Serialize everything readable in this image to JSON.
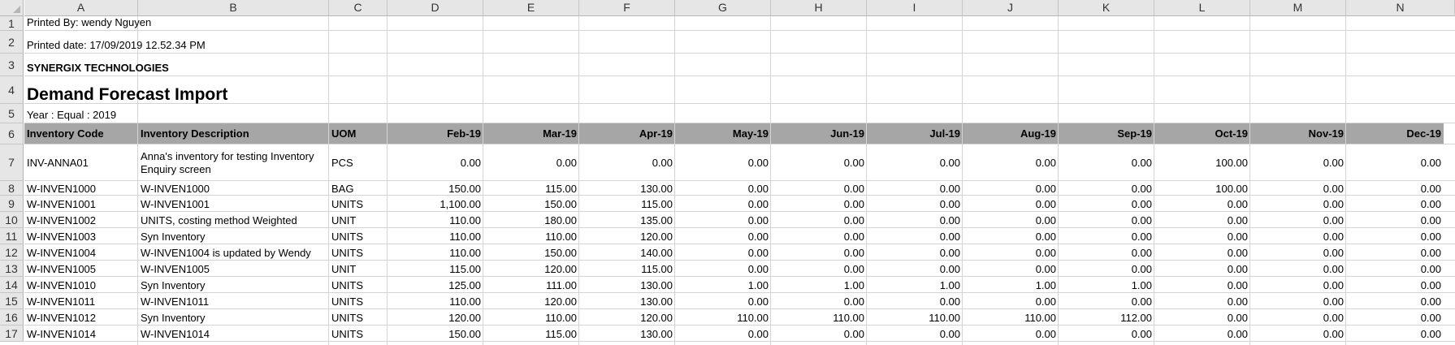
{
  "columns": [
    "A",
    "B",
    "C",
    "D",
    "E",
    "F",
    "G",
    "H",
    "I",
    "J",
    "K",
    "L",
    "M",
    "N"
  ],
  "rows": [
    "1",
    "2",
    "3",
    "4",
    "5",
    "6",
    "7",
    "8",
    "9",
    "10",
    "11",
    "12",
    "13",
    "14",
    "15",
    "16",
    "17"
  ],
  "report": {
    "printed_by": "Printed By: wendy Nguyen",
    "printed_date": "Printed date: 17/09/2019 12.52.34 PM",
    "company": "SYNERGIX TECHNOLOGIES",
    "title": "Demand Forecast Import",
    "filter": "Year : Equal : 2019"
  },
  "table_headers": [
    "Inventory Code",
    "Inventory Description",
    "UOM",
    "Feb-19",
    "Mar-19",
    "Apr-19",
    "May-19",
    "Jun-19",
    "Jul-19",
    "Aug-19",
    "Sep-19",
    "Oct-19",
    "Nov-19",
    "Dec-19"
  ],
  "table_rows": [
    [
      "INV-ANNA01",
      "Anna's inventory for testing Inventory Enquiry screen",
      "PCS",
      "0.00",
      "0.00",
      "0.00",
      "0.00",
      "0.00",
      "0.00",
      "0.00",
      "0.00",
      "100.00",
      "0.00",
      "0.00"
    ],
    [
      "W-INVEN1000",
      "W-INVEN1000",
      "BAG",
      "150.00",
      "115.00",
      "130.00",
      "0.00",
      "0.00",
      "0.00",
      "0.00",
      "0.00",
      "100.00",
      "0.00",
      "0.00"
    ],
    [
      "W-INVEN1001",
      "W-INVEN1001",
      "UNITS",
      "1,100.00",
      "150.00",
      "115.00",
      "0.00",
      "0.00",
      "0.00",
      "0.00",
      "0.00",
      "0.00",
      "0.00",
      "0.00"
    ],
    [
      "W-INVEN1002",
      "UNITS, costing method Weighted",
      "UNIT",
      "110.00",
      "180.00",
      "135.00",
      "0.00",
      "0.00",
      "0.00",
      "0.00",
      "0.00",
      "0.00",
      "0.00",
      "0.00"
    ],
    [
      "W-INVEN1003",
      "Syn Inventory",
      "UNITS",
      "110.00",
      "110.00",
      "120.00",
      "0.00",
      "0.00",
      "0.00",
      "0.00",
      "0.00",
      "0.00",
      "0.00",
      "0.00"
    ],
    [
      "W-INVEN1004",
      "W-INVEN1004 is updated by Wendy",
      "UNITS",
      "110.00",
      "150.00",
      "140.00",
      "0.00",
      "0.00",
      "0.00",
      "0.00",
      "0.00",
      "0.00",
      "0.00",
      "0.00"
    ],
    [
      "W-INVEN1005",
      "W-INVEN1005",
      "UNIT",
      "115.00",
      "120.00",
      "115.00",
      "0.00",
      "0.00",
      "0.00",
      "0.00",
      "0.00",
      "0.00",
      "0.00",
      "0.00"
    ],
    [
      "W-INVEN1010",
      "Syn Inventory",
      "UNITS",
      "125.00",
      "111.00",
      "130.00",
      "1.00",
      "1.00",
      "1.00",
      "1.00",
      "1.00",
      "0.00",
      "0.00",
      "0.00"
    ],
    [
      "W-INVEN1011",
      "W-INVEN1011",
      "UNITS",
      "110.00",
      "120.00",
      "130.00",
      "0.00",
      "0.00",
      "0.00",
      "0.00",
      "0.00",
      "0.00",
      "0.00",
      "0.00"
    ],
    [
      "W-INVEN1012",
      "Syn Inventory",
      "UNITS",
      "120.00",
      "110.00",
      "120.00",
      "110.00",
      "110.00",
      "110.00",
      "110.00",
      "112.00",
      "0.00",
      "0.00",
      "0.00"
    ],
    [
      "W-INVEN1014",
      "W-INVEN1014",
      "UNITS",
      "150.00",
      "115.00",
      "130.00",
      "0.00",
      "0.00",
      "0.00",
      "0.00",
      "0.00",
      "0.00",
      "0.00",
      "0.00"
    ]
  ],
  "colors": {
    "header_band": "#a6a6a6",
    "gridline": "#d4d4d4",
    "heading_bg": "#e6e6e6"
  }
}
